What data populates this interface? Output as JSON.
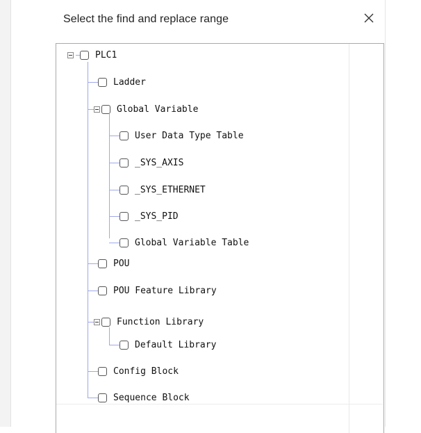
{
  "dialog": {
    "title": "Select the find and replace range",
    "close_glyph": "✕"
  },
  "tree": {
    "root": "PLC1",
    "nodes": {
      "ladder": "Ladder",
      "global_variable": "Global Variable",
      "user_data_type_table": "User Data Type Table",
      "sys_axis": "_SYS_AXIS",
      "sys_ethernet": "_SYS_ETHERNET",
      "sys_pid": "_SYS_PID",
      "global_variable_table": "Global Variable Table",
      "pou": "POU",
      "pou_feature_library": "POU Feature Library",
      "function_library": "Function Library",
      "default_library": "Default Library",
      "config_block": "Config Block",
      "sequence_block": "Sequence Block"
    }
  },
  "colors": {
    "tree_line": "#9fa8e8",
    "checkbox_border": "#555555",
    "text": "#111111"
  }
}
